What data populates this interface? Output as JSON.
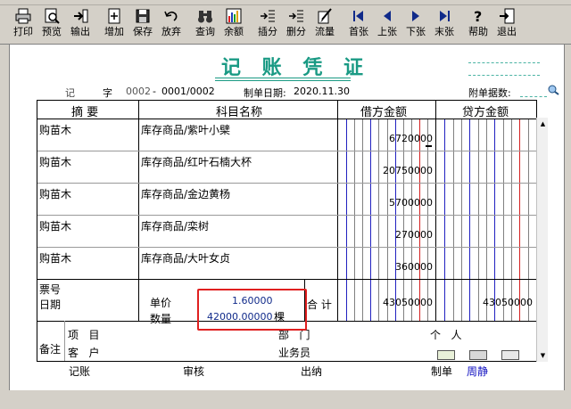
{
  "toolbar": {
    "buttons": [
      {
        "label": "打印",
        "icon": "printer-icon"
      },
      {
        "label": "预览",
        "icon": "preview-icon"
      },
      {
        "label": "输出",
        "icon": "export-icon"
      },
      {
        "label": "增加",
        "icon": "add-icon"
      },
      {
        "label": "保存",
        "icon": "save-icon"
      },
      {
        "label": "放弃",
        "icon": "undo-icon"
      },
      {
        "label": "查询",
        "icon": "binoculars-icon"
      },
      {
        "label": "余额",
        "icon": "balance-chart-icon"
      },
      {
        "label": "插分",
        "icon": "insert-entry-icon"
      },
      {
        "label": "删分",
        "icon": "delete-entry-icon"
      },
      {
        "label": "流量",
        "icon": "cashflow-icon"
      },
      {
        "label": "首张",
        "icon": "first-page-icon"
      },
      {
        "label": "上张",
        "icon": "prev-page-icon"
      },
      {
        "label": "下张",
        "icon": "next-page-icon"
      },
      {
        "label": "末张",
        "icon": "last-page-icon"
      },
      {
        "label": "帮助",
        "icon": "help-icon"
      },
      {
        "label": "退出",
        "icon": "exit-icon"
      }
    ]
  },
  "voucher": {
    "title": "记 账 凭 证",
    "type_char": "记",
    "zi": "字",
    "number_prefix": "0002",
    "number_dash": "-",
    "number_seq": "0001/0002",
    "date_label": "制单日期:",
    "date": "2020.11.30",
    "attachments_label": "附单据数:",
    "col_summary": "摘 要",
    "col_account": "科目名称",
    "col_debit": "借方金额",
    "col_credit": "贷方金额",
    "rows": [
      {
        "summary": "购苗木",
        "account": "库存商品/紫叶小檗",
        "debit": "6720000",
        "credit": ""
      },
      {
        "summary": "购苗木",
        "account": "库存商品/红叶石楠大杯",
        "debit": "20750000",
        "credit": ""
      },
      {
        "summary": "购苗木",
        "account": "库存商品/金边黄杨",
        "debit": "5700000",
        "credit": ""
      },
      {
        "summary": "购苗木",
        "account": "库存商品/栾树",
        "debit": "270000",
        "credit": ""
      },
      {
        "summary": "购苗木",
        "account": "库存商品/大叶女贞",
        "debit": "360000",
        "credit": ""
      }
    ],
    "ticket_label": "票号",
    "date_row_label": "日期",
    "unit_price_label": "单价",
    "unit_price": "1.60000",
    "quantity_label": "数量",
    "quantity": "42000.00000",
    "quantity_unit": "棵",
    "total_label": "合 计",
    "total_debit": "43050000",
    "total_credit": "43050000",
    "note_label": "备注",
    "project_label": "项   目",
    "customer_label": "客   户",
    "dept_label": "部   门",
    "person_label": "个   人",
    "salesman_label": "业务员"
  },
  "footer": {
    "bookkeeper_label": "记账",
    "review_label": "审核",
    "cashier_label": "出纳",
    "maker_label": "制单",
    "maker_name": "周静"
  },
  "colors": {
    "title_teal": "#1a9a84",
    "highlight_red": "#e02020",
    "grid_red": "#d42020",
    "grid_blue": "#2020c0",
    "amount_blue": "#1030b0",
    "maker_blue": "#1010c0"
  }
}
